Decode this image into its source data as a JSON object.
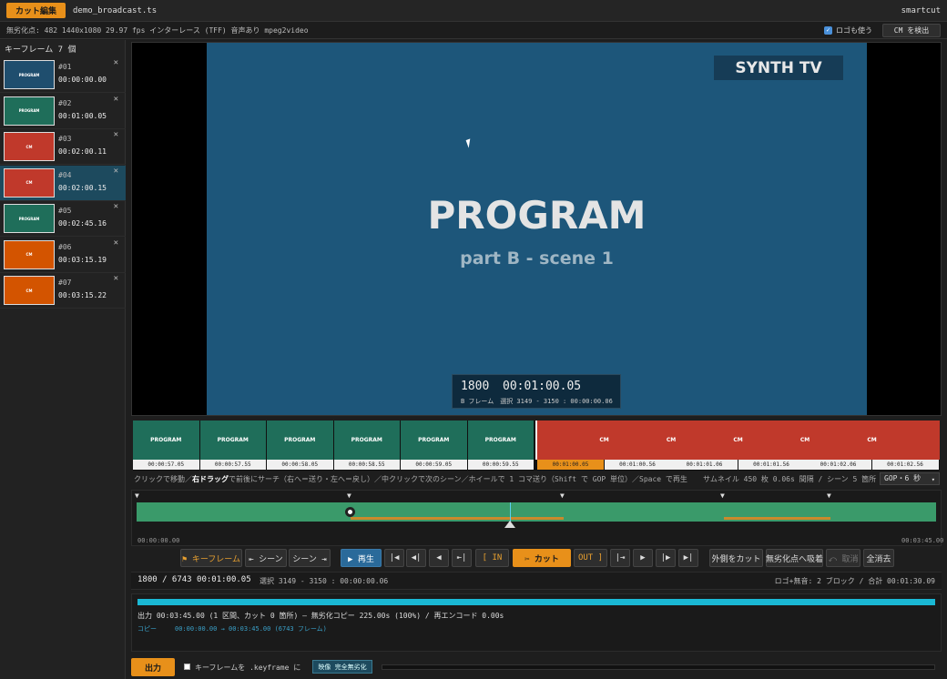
{
  "header": {
    "mode_tab": "カット編集",
    "filename": "demo_broadcast.ts",
    "app_name": "smartcut"
  },
  "info": {
    "text": "無劣化点: 482 1440x1080 29.97 fps インターレース (TFF) 音声あり mpeg2video",
    "logo_label": "ロゴも使う",
    "cm_button": "CM を検出"
  },
  "keyframes": {
    "header": "キーフレーム 7 個",
    "items": [
      {
        "num": "#01",
        "time": "00:00:00.00",
        "kind": "PROGRAM",
        "color": "#1f4e6e"
      },
      {
        "num": "#02",
        "time": "00:01:00.05",
        "kind": "PROGRAM",
        "color": "#1f6e5a"
      },
      {
        "num": "#03",
        "time": "00:02:00.11",
        "kind": "CM",
        "color": "#c0392b"
      },
      {
        "num": "#04",
        "time": "00:02:00.15",
        "kind": "CM",
        "color": "#c0392b"
      },
      {
        "num": "#05",
        "time": "00:02:45.16",
        "kind": "PROGRAM",
        "color": "#1f6e5a"
      },
      {
        "num": "#06",
        "time": "00:03:15.19",
        "kind": "CM",
        "color": "#d35400"
      },
      {
        "num": "#07",
        "time": "00:03:15.22",
        "kind": "CM",
        "color": "#d35400"
      }
    ],
    "close_symbol": "✕"
  },
  "video": {
    "channel_logo": "SYNTH TV",
    "title": "PROGRAM",
    "subtitle": "part B - scene 1",
    "frame": "1800",
    "timecode": "00:01:00.05",
    "frame_detail": "B フレーム　選択 3149 - 3150 : 00:00:00.06",
    "bg_color": "#1d567a"
  },
  "strip": {
    "left_label": "PROGRAM",
    "right_label": "CM",
    "left_times": [
      "00:00:57.05",
      "00:00:57.55",
      "00:00:58.05",
      "00:00:58.55",
      "00:00:59.05",
      "00:00:59.55"
    ],
    "current_time": "00:01:00.05",
    "right_times": [
      "00:01:00.56",
      "00:01:01.06",
      "00:01:01.56",
      "00:01:02.06",
      "00:01:02.56"
    ]
  },
  "hint": {
    "text_a": "クリックで移動／",
    "text_bold": "右ドラッグ",
    "text_b": "で前後にサーチ（右へ＝送り・左へ＝戻し）／中クリックで次のシーン／ホイールで 1 コマ送り（Shift で GOP 単位）／Space で再生",
    "thumb_info": "サムネイル 450 枚 0.06s 間隔 / シーン 5 箇所　表示",
    "gop_select": "GOP・6 秒"
  },
  "timeline": {
    "start": "00:00:00.00",
    "end": "00:03:45.00"
  },
  "controls": {
    "keyframe": "⚑ キーフレーム",
    "prev_scene": "⇤ シーン",
    "next_scene": "シーン ⇥",
    "play": "▶ 再生",
    "b1": "|◀",
    "b2": "◀|",
    "b3": "◀",
    "b4": "⇤|",
    "in": "[ IN",
    "cut": "✂ カット",
    "out": "OUT ]",
    "b5": "|⇥",
    "b6": "▶",
    "b7": "|▶",
    "b8": "▶|",
    "cut_outside": "外側をカット",
    "snap": "無劣化点へ吸着",
    "undo": "⤺ 取消",
    "clear": "全消去"
  },
  "status": {
    "position": "1800 / 6743 00:01:00.05",
    "selection": "選択 3149 - 3150 : 00:00:00.06",
    "logo_silence": "ロゴ+無音: 2 ブロック / 合計 00:01:30.09"
  },
  "output": {
    "progress": 1.0,
    "summary": "出力 00:03:45.00 (1 区間、カット 0 箇所) — 無劣化コピー 225.00s (100%) / 再エンコード 0.00s",
    "copy_label": "コピー",
    "copy_range": "00:00:00.00 → 00:03:45.00 (6743 フレーム)",
    "export_button": "出力",
    "keyframe_text": "キーフレームを .keyframe に",
    "badge": "映像 完全無劣化"
  }
}
